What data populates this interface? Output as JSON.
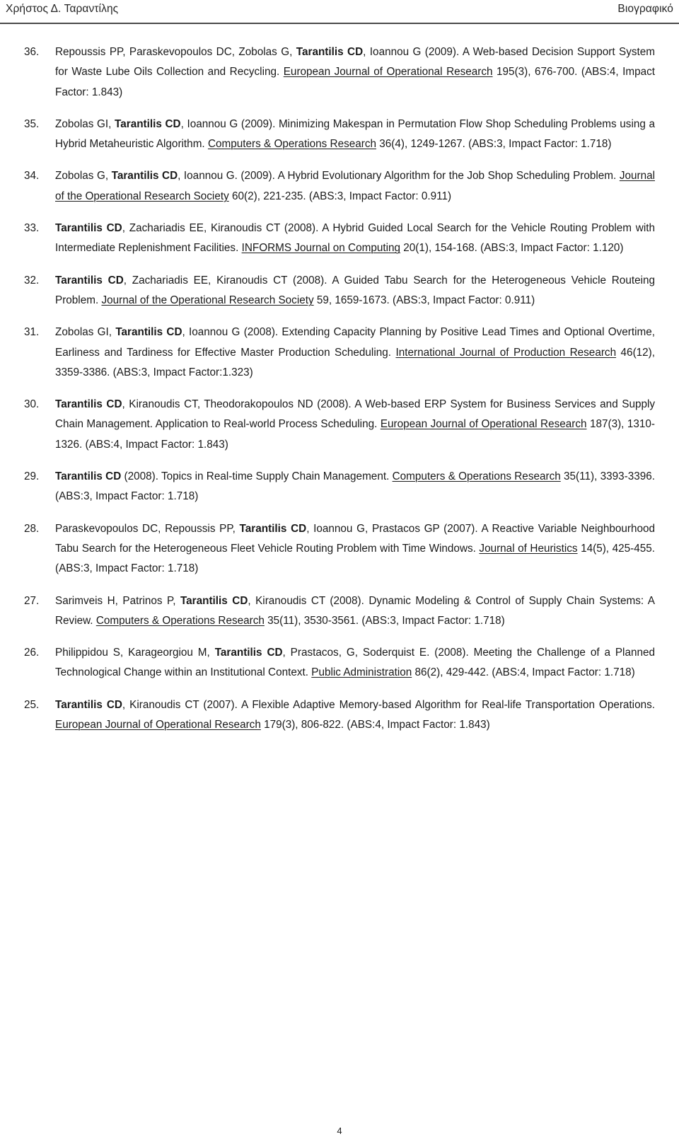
{
  "header": {
    "left": "Χρήστος Δ. Ταραντίλης",
    "right": "Βιογραφικό"
  },
  "footer": {
    "page_number": "4"
  },
  "references": [
    {
      "number": "36.",
      "html": "Repoussis PP, Paraskevopoulos DC, Zobolas G, <b>Tarantilis CD</b>, Ioannou G (2009). A Web-based Decision Support System for Waste Lube Oils Collection and Recycling. <u>European Journal of Operational Research</u> 195(3), 676-700. (ABS:4, Impact Factor: 1.843)",
      "plain": "Repoussis PP, Paraskevopoulos DC, Zobolas G, Tarantilis CD, Ioannou G (2009). A Web-based Decision Support System for Waste Lube Oils Collection and Recycling. European Journal of Operational Research 195(3), 676-700. (ABS:4, Impact Factor: 1.843)",
      "journal": "European Journal of Operational Research",
      "year": "2009",
      "volume_issue": "195(3)",
      "pages": "676-700",
      "abs": "4",
      "impact_factor": "1.843"
    },
    {
      "number": "35.",
      "html": "Zobolas GI, <b>Tarantilis CD</b>, Ioannou G (2009). Minimizing Makespan in Permutation Flow Shop Scheduling Problems using a Hybrid Metaheuristic Algorithm. <u>Computers &amp; Operations Research</u> 36(4), 1249-1267. (ABS:3, Impact Factor: 1.718)",
      "plain": "Zobolas GI, Tarantilis CD, Ioannou G (2009). Minimizing Makespan in Permutation Flow Shop Scheduling Problems using a Hybrid Metaheuristic Algorithm. Computers & Operations Research 36(4), 1249-1267. (ABS:3, Impact Factor: 1.718)",
      "journal": "Computers & Operations Research",
      "year": "2009",
      "volume_issue": "36(4)",
      "pages": "1249-1267",
      "abs": "3",
      "impact_factor": "1.718"
    },
    {
      "number": "34.",
      "html": "Zobolas G, <b>Tarantilis CD</b>, Ioannou G. (2009). A Hybrid Evolutionary Algorithm for the Job Shop Scheduling Problem. <u>Journal of the Operational Research Society</u> 60(2), 221-235. (ABS:3, Impact Factor: 0.911)",
      "plain": "Zobolas G, Tarantilis CD, Ioannou G. (2009). A Hybrid Evolutionary Algorithm for the Job Shop Scheduling Problem. Journal of the Operational Research Society 60(2), 221-235. (ABS:3, Impact Factor: 0.911)",
      "journal": "Journal of the Operational Research Society",
      "year": "2009",
      "volume_issue": "60(2)",
      "pages": "221-235",
      "abs": "3",
      "impact_factor": "0.911"
    },
    {
      "number": "33.",
      "html": "<b>Tarantilis CD</b>, Zachariadis EE, Kiranoudis CT (2008). A Hybrid Guided Local Search for the Vehicle Routing Problem with Intermediate Replenishment Facilities. <u>INFORMS Journal on Computing</u> 20(1), 154-168. (ABS:3, Impact Factor: 1.120)",
      "plain": "Tarantilis CD, Zachariadis EE, Kiranoudis CT (2008). A Hybrid Guided Local Search for the Vehicle Routing Problem with Intermediate Replenishment Facilities. INFORMS Journal on Computing 20(1), 154-168. (ABS:3, Impact Factor: 1.120)",
      "journal": "INFORMS Journal on Computing",
      "year": "2008",
      "volume_issue": "20(1)",
      "pages": "154-168",
      "abs": "3",
      "impact_factor": "1.120"
    },
    {
      "number": "32.",
      "html": "<b>Tarantilis CD</b>, Zachariadis EE, Kiranoudis CT (2008). A Guided Tabu Search for the Heterogeneous Vehicle Routeing Problem. <u>Journal of the Operational Research Society</u> 59, 1659-1673. (ABS:3, Impact Factor: 0.911)",
      "plain": "Tarantilis CD, Zachariadis EE, Kiranoudis CT (2008). A Guided Tabu Search for the Heterogeneous Vehicle Routeing Problem. Journal of the Operational Research Society 59, 1659-1673. (ABS:3, Impact Factor: 0.911)",
      "journal": "Journal of the Operational Research Society",
      "year": "2008",
      "volume_issue": "59",
      "pages": "1659-1673",
      "abs": "3",
      "impact_factor": "0.911"
    },
    {
      "number": "31.",
      "html": "Zobolas GI, <b>Tarantilis CD</b>, Ioannou G (2008). Extending Capacity Planning by Positive Lead Times and Optional Overtime, Earliness and Tardiness for Effective Master Production Scheduling. <u>International Journal of Production Research</u> 46(12), 3359-3386. (ABS:3, Impact Factor:1.323)",
      "plain": "Zobolas GI, Tarantilis CD, Ioannou G (2008). Extending Capacity Planning by Positive Lead Times and Optional Overtime, Earliness and Tardiness for Effective Master Production Scheduling. International Journal of Production Research 46(12), 3359-3386. (ABS:3, Impact Factor:1.323)",
      "journal": "International Journal of Production Research",
      "year": "2008",
      "volume_issue": "46(12)",
      "pages": "3359-3386",
      "abs": "3",
      "impact_factor": "1.323"
    },
    {
      "number": "30.",
      "html": "<b>Tarantilis CD</b>, Kiranoudis CT, Theodorakopoulos ND (2008). A Web-based ERP System for Business Services and Supply Chain Management. Application to Real-world Process Scheduling. <u>European Journal of Operational Research</u> 187(3), 1310-1326. (ABS:4, Impact Factor: 1.843)",
      "plain": "Tarantilis CD, Kiranoudis CT, Theodorakopoulos ND (2008). A Web-based ERP System for Business Services and Supply Chain Management. Application to Real-world Process Scheduling. European Journal of Operational Research 187(3), 1310-1326. (ABS:4, Impact Factor: 1.843)",
      "journal": "European Journal of Operational Research",
      "year": "2008",
      "volume_issue": "187(3)",
      "pages": "1310-1326",
      "abs": "4",
      "impact_factor": "1.843"
    },
    {
      "number": "29.",
      "html": "<b>Tarantilis CD</b> (2008). Topics in Real-time Supply Chain Management. <u>Computers &amp; Operations Research</u> 35(11), 3393-3396. (ABS:3, Impact Factor: 1.718)",
      "plain": "Tarantilis CD (2008). Topics in Real-time Supply Chain Management. Computers & Operations Research 35(11), 3393-3396. (ABS:3, Impact Factor: 1.718)",
      "journal": "Computers & Operations Research",
      "year": "2008",
      "volume_issue": "35(11)",
      "pages": "3393-3396",
      "abs": "3",
      "impact_factor": "1.718"
    },
    {
      "number": "28.",
      "html": "Paraskevopoulos DC, Repoussis PP, <b>Tarantilis CD</b>, Ioannou G, Prastacos GP (2007). A Reactive Variable Neighbourhood Tabu Search for the Heterogeneous Fleet Vehicle Routing Problem with Time Windows. <u>Journal of Heuristics</u> 14(5), 425-455. (ABS:3, Impact Factor: 1.718)",
      "plain": "Paraskevopoulos DC, Repoussis PP, Tarantilis CD, Ioannou G, Prastacos GP (2007). A Reactive Variable Neighbourhood Tabu Search for the Heterogeneous Fleet Vehicle Routing Problem with Time Windows. Journal of Heuristics 14(5), 425-455. (ABS:3, Impact Factor: 1.718)",
      "journal": "Journal of Heuristics",
      "year": "2007",
      "volume_issue": "14(5)",
      "pages": "425-455",
      "abs": "3",
      "impact_factor": "1.718"
    },
    {
      "number": "27.",
      "html": "Sarimveis H, Patrinos P, <b>Tarantilis CD</b>, Kiranoudis CT (2008). Dynamic Modeling &amp; Control of Supply Chain Systems: A Review. <u>Computers &amp; Operations Research</u> 35(11), 3530-3561. (ABS:3, Impact Factor: 1.718)",
      "plain": "Sarimveis H, Patrinos P, Tarantilis CD, Kiranoudis CT (2008). Dynamic Modeling & Control of Supply Chain Systems: A Review. Computers & Operations Research 35(11), 3530-3561. (ABS:3, Impact Factor: 1.718)",
      "journal": "Computers & Operations Research",
      "year": "2008",
      "volume_issue": "35(11)",
      "pages": "3530-3561",
      "abs": "3",
      "impact_factor": "1.718"
    },
    {
      "number": "26.",
      "html": "Philippidou S, Karageorgiou M, <b>Tarantilis CD</b>, Prastacos, G, Soderquist E. (2008). Meeting the Challenge of a Planned Technological Change within an Institutional Context. <u>Public Administration</u> 86(2), 429-442. (ABS:4, Impact Factor: 1.718)",
      "plain": "Philippidou S, Karageorgiou M, Tarantilis CD, Prastacos, G, Soderquist E. (2008). Meeting the Challenge of a Planned Technological Change within an Institutional Context. Public Administration 86(2), 429-442. (ABS:4, Impact Factor: 1.718)",
      "journal": "Public Administration",
      "year": "2008",
      "volume_issue": "86(2)",
      "pages": "429-442",
      "abs": "4",
      "impact_factor": "1.718"
    },
    {
      "number": "25.",
      "html": "<b>Tarantilis CD</b>, Kiranoudis CT (2007). A Flexible Adaptive Memory-based Algorithm for Real-life Transportation Operations. <u>European Journal of Operational Research</u> 179(3), 806-822. (ABS:4, Impact Factor: 1.843)",
      "plain": "Tarantilis CD, Kiranoudis CT (2007). A Flexible Adaptive Memory-based Algorithm for Real-life Transportation Operations. European Journal of Operational Research 179(3), 806-822. (ABS:4, Impact Factor: 1.843)",
      "journal": "European Journal of Operational Research",
      "year": "2007",
      "volume_issue": "179(3)",
      "pages": "806-822",
      "abs": "4",
      "impact_factor": "1.843"
    }
  ]
}
